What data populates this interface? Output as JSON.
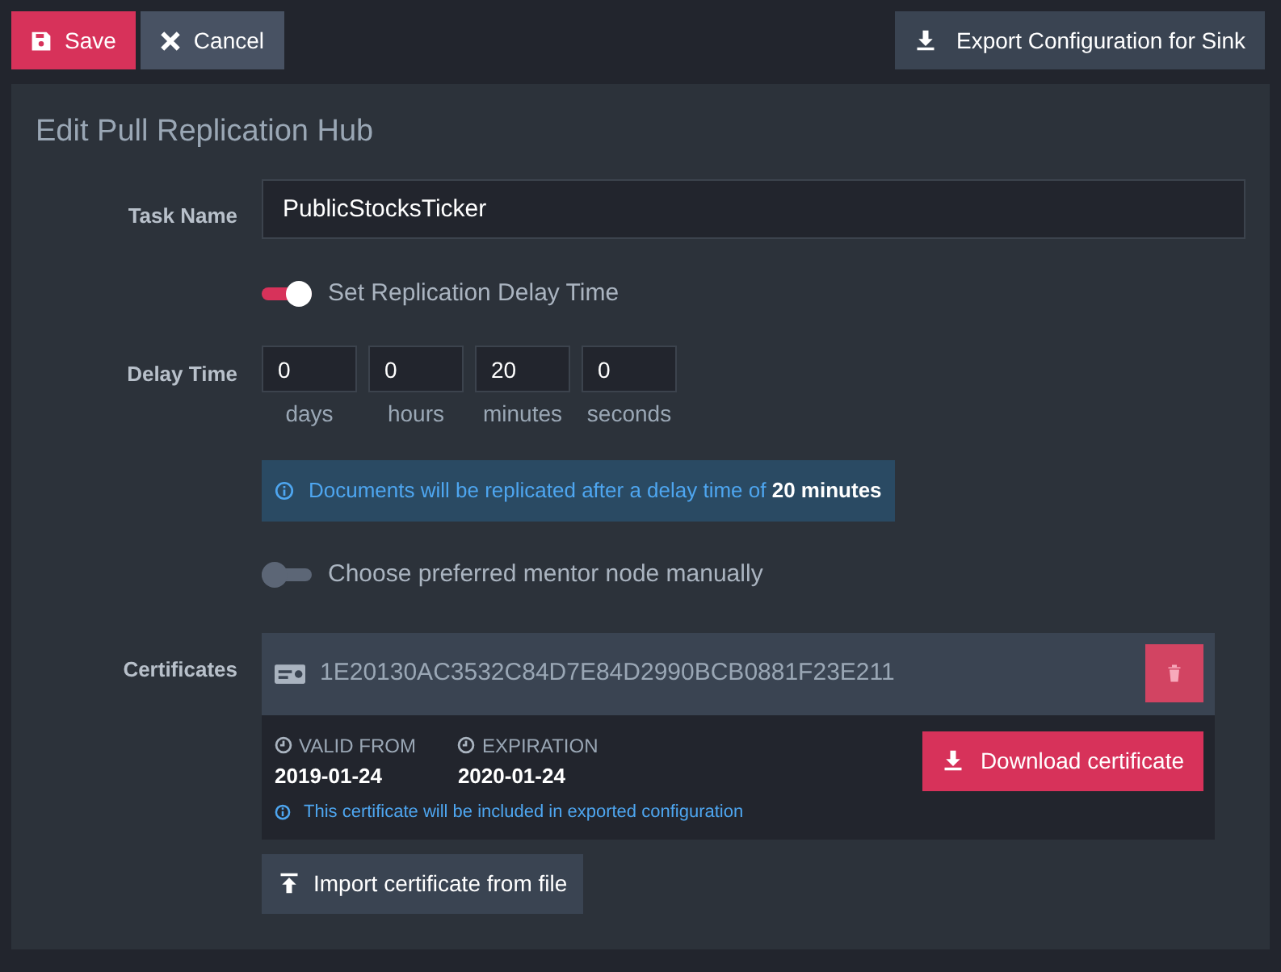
{
  "toolbar": {
    "save": "Save",
    "cancel": "Cancel",
    "export": "Export Configuration for Sink"
  },
  "title": "Edit Pull Replication Hub",
  "task_name": {
    "label": "Task Name",
    "value": "PublicStocksTicker"
  },
  "delay_toggle": {
    "label": "Set Replication Delay Time",
    "on": true
  },
  "delay_time": {
    "label": "Delay Time",
    "fields": [
      {
        "value": "0",
        "unit": "days"
      },
      {
        "value": "0",
        "unit": "hours"
      },
      {
        "value": "20",
        "unit": "minutes"
      },
      {
        "value": "0",
        "unit": "seconds"
      }
    ]
  },
  "delay_info": "Documents will be replicated after a delay time of **20 minutes**",
  "mentor_toggle": {
    "label": "Choose preferred mentor node manually",
    "on": false
  },
  "certificates": {
    "label": "Certificates",
    "items": [
      {
        "thumbprint": "1E20130AC3532C84D7E84D2990BCB0881F23E211",
        "valid_from_label": "VALID FROM",
        "valid_from": "2019-01-24",
        "expiration_label": "EXPIRATION",
        "expiration": "2020-01-24",
        "note": "This certificate will be included in exported configuration",
        "download": "Download certificate"
      }
    ],
    "import": "Import certificate from file"
  }
}
